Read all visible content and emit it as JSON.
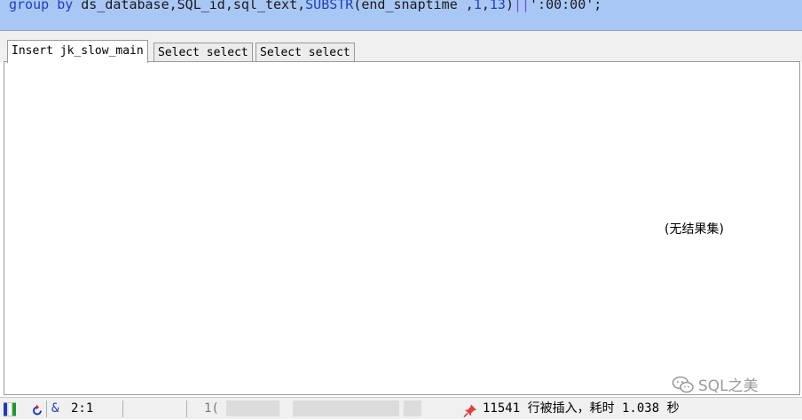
{
  "editor": {
    "tokens": [
      {
        "t": "group",
        "c": "kw"
      },
      {
        "t": " ",
        "c": "op"
      },
      {
        "t": "by",
        "c": "kw"
      },
      {
        "t": " ds_database,SQL_id,sql_text,",
        "c": "op"
      },
      {
        "t": "SUBSTR",
        "c": "fn"
      },
      {
        "t": "(end_snaptime ,",
        "c": "op"
      },
      {
        "t": "1",
        "c": "fn"
      },
      {
        "t": ",",
        "c": "op"
      },
      {
        "t": "13",
        "c": "fn"
      },
      {
        "t": ")",
        "c": "op"
      },
      {
        "t": "||",
        "c": "str"
      },
      {
        "t": "':00:00'",
        "c": "op"
      },
      {
        "t": ";",
        "c": "op"
      }
    ]
  },
  "tabs": [
    {
      "label": "Insert jk_slow_main",
      "active": true
    },
    {
      "label": "Select select",
      "active": false
    },
    {
      "label": "Select select",
      "active": false
    }
  ],
  "results": {
    "empty_message": "(无结果集)"
  },
  "watermark": {
    "text": "SQL之美"
  },
  "status": {
    "cursor": "2:1",
    "amp": "&",
    "partial_a": "1(",
    "message": "11541 行被插入，耗时 1.038 秒"
  },
  "colors": {
    "editor_bg": "#a9c7f5",
    "keyword": "#1f3fbf"
  }
}
